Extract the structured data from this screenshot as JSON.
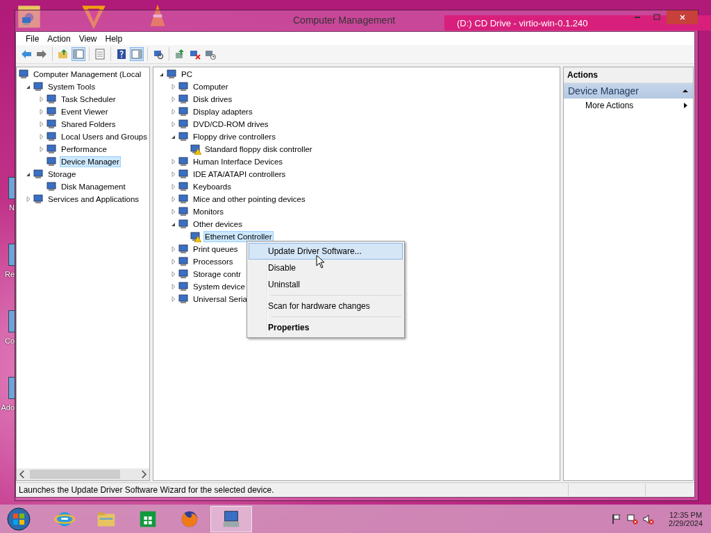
{
  "desktop": {
    "icons": [
      {
        "label": "N"
      },
      {
        "label": "Re"
      },
      {
        "label": "Co"
      },
      {
        "label": "Ado"
      }
    ],
    "background_window": {
      "title": "(D:) CD Drive - virtio-win-0.1.240"
    }
  },
  "window": {
    "title": "Computer Management"
  },
  "menu_bar": [
    "File",
    "Action",
    "View",
    "Help"
  ],
  "toolbar": [
    {
      "kind": "back",
      "pressed": false
    },
    {
      "kind": "forward",
      "pressed": false
    },
    {
      "kind": "sep"
    },
    {
      "kind": "up",
      "pressed": false
    },
    {
      "kind": "tree",
      "pressed": true
    },
    {
      "kind": "sep"
    },
    {
      "kind": "list",
      "pressed": false
    },
    {
      "kind": "sep"
    },
    {
      "kind": "help",
      "pressed": false
    },
    {
      "kind": "pane",
      "pressed": true
    },
    {
      "kind": "sep"
    },
    {
      "kind": "scan",
      "pressed": false
    },
    {
      "kind": "sep"
    },
    {
      "kind": "update",
      "pressed": false
    },
    {
      "kind": "remove",
      "pressed": false
    },
    {
      "kind": "enable",
      "pressed": false
    }
  ],
  "console_tree": [
    {
      "label": "Computer Management (Local",
      "selected": false,
      "children": [
        {
          "label": "System Tools",
          "expanded": true,
          "selected": false,
          "children": [
            {
              "label": "Task Scheduler",
              "expanded": false,
              "selected": false
            },
            {
              "label": "Event Viewer",
              "expanded": false,
              "selected": false
            },
            {
              "label": "Shared Folders",
              "expanded": false,
              "selected": false
            },
            {
              "label": "Local Users and Groups",
              "expanded": false,
              "selected": false
            },
            {
              "label": "Performance",
              "expanded": false,
              "selected": false
            },
            {
              "label": "Device Manager",
              "selected": true
            }
          ]
        },
        {
          "label": "Storage",
          "expanded": true,
          "selected": false,
          "children": [
            {
              "label": "Disk Management",
              "selected": false
            }
          ]
        },
        {
          "label": "Services and Applications",
          "expanded": false,
          "selected": false
        }
      ]
    }
  ],
  "device_tree": [
    {
      "label": "PC",
      "expanded": true,
      "selected": false,
      "children": [
        {
          "label": "Computer",
          "expanded": false,
          "selected": false
        },
        {
          "label": "Disk drives",
          "expanded": false,
          "selected": false
        },
        {
          "label": "Display adapters",
          "expanded": false,
          "selected": false
        },
        {
          "label": "DVD/CD-ROM drives",
          "expanded": false,
          "selected": false
        },
        {
          "label": "Floppy drive controllers",
          "expanded": true,
          "selected": false,
          "children": [
            {
              "label": "Standard floppy disk controller",
              "selected": false,
              "warning": true
            }
          ]
        },
        {
          "label": "Human Interface Devices",
          "expanded": false,
          "selected": false
        },
        {
          "label": "IDE ATA/ATAPI controllers",
          "expanded": false,
          "selected": false
        },
        {
          "label": "Keyboards",
          "expanded": false,
          "selected": false
        },
        {
          "label": "Mice and other pointing devices",
          "expanded": false,
          "selected": false
        },
        {
          "label": "Monitors",
          "expanded": false,
          "selected": false
        },
        {
          "label": "Other devices",
          "expanded": true,
          "selected": false,
          "children": [
            {
              "label": "Ethernet Controller",
              "selected": true,
              "warning": true
            }
          ]
        },
        {
          "label": "Print queues",
          "expanded": false,
          "selected": false
        },
        {
          "label": "Processors",
          "expanded": false,
          "selected": false
        },
        {
          "label": "Storage contr",
          "expanded": false,
          "selected": false
        },
        {
          "label": "System device",
          "expanded": false,
          "selected": false
        },
        {
          "label": "Universal Seria",
          "expanded": false,
          "selected": false
        }
      ]
    }
  ],
  "actions_pane": {
    "header": "Actions",
    "section": {
      "title": "Device Manager",
      "expanded": true
    },
    "items": [
      {
        "label": "More Actions"
      }
    ]
  },
  "context_menu": [
    [
      {
        "label": "Update Driver Software...",
        "selected": true,
        "default": false
      },
      {
        "label": "Disable",
        "selected": false,
        "default": false
      },
      {
        "label": "Uninstall",
        "selected": false,
        "default": false
      }
    ],
    [
      {
        "label": "Scan for hardware changes",
        "selected": false,
        "default": false
      }
    ],
    [
      {
        "label": "Properties",
        "selected": false,
        "default": true
      }
    ]
  ],
  "status_bar": "Launches the Update Driver Software Wizard for the selected device.",
  "taskbar": {
    "apps": [
      {
        "kind": "start",
        "selected": false
      },
      {
        "kind": "browser",
        "selected": false
      },
      {
        "kind": "folder",
        "selected": false
      },
      {
        "kind": "store",
        "selected": false
      },
      {
        "kind": "firefox",
        "selected": false
      },
      {
        "kind": "computer",
        "selected": true
      }
    ],
    "time": "12:35 PM",
    "date": "2/29/2024"
  }
}
